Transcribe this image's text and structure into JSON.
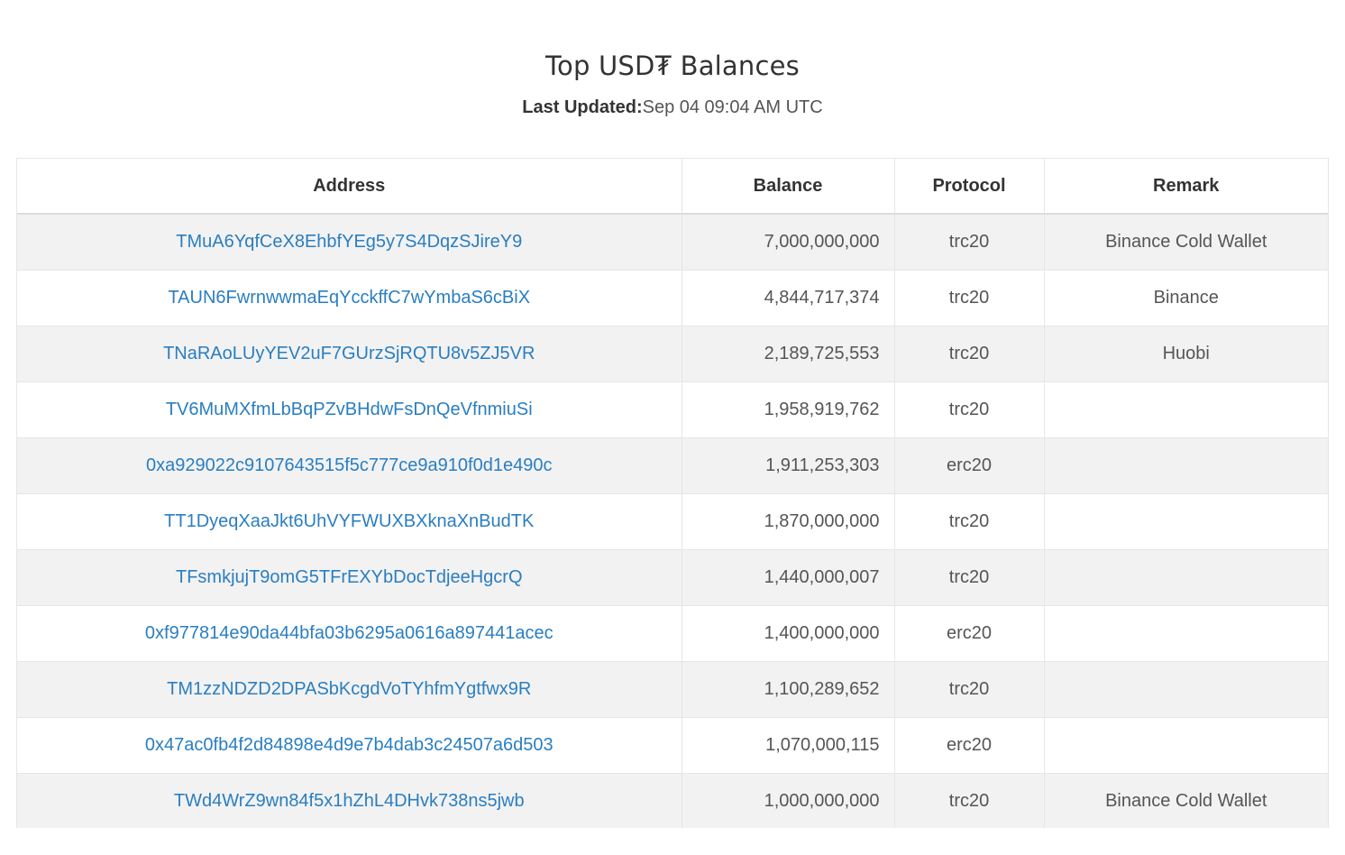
{
  "header": {
    "title": "Top USD₮ Balances",
    "updated_label": "Last Updated:",
    "updated_value": "Sep 04 09:04 AM UTC"
  },
  "table": {
    "columns": [
      "Address",
      "Balance",
      "Protocol",
      "Remark"
    ],
    "rows": [
      {
        "address": "TMuA6YqfCeX8EhbfYEg5y7S4DqzSJireY9",
        "balance": "7,000,000,000",
        "protocol": "trc20",
        "remark": "Binance Cold Wallet"
      },
      {
        "address": "TAUN6FwrnwwmaEqYcckffC7wYmbaS6cBiX",
        "balance": "4,844,717,374",
        "protocol": "trc20",
        "remark": "Binance"
      },
      {
        "address": "TNaRAoLUyYEV2uF7GUrzSjRQTU8v5ZJ5VR",
        "balance": "2,189,725,553",
        "protocol": "trc20",
        "remark": "Huobi"
      },
      {
        "address": "TV6MuMXfmLbBqPZvBHdwFsDnQeVfnmiuSi",
        "balance": "1,958,919,762",
        "protocol": "trc20",
        "remark": ""
      },
      {
        "address": "0xa929022c9107643515f5c777ce9a910f0d1e490c",
        "balance": "1,911,253,303",
        "protocol": "erc20",
        "remark": ""
      },
      {
        "address": "TT1DyeqXaaJkt6UhVYFWUXBXknaXnBudTK",
        "balance": "1,870,000,000",
        "protocol": "trc20",
        "remark": ""
      },
      {
        "address": "TFsmkjujT9omG5TFrEXYbDocTdjeeHgcrQ",
        "balance": "1,440,000,007",
        "protocol": "trc20",
        "remark": ""
      },
      {
        "address": "0xf977814e90da44bfa03b6295a0616a897441acec",
        "balance": "1,400,000,000",
        "protocol": "erc20",
        "remark": ""
      },
      {
        "address": "TM1zzNDZD2DPASbKcgdVoTYhfmYgtfwx9R",
        "balance": "1,100,289,652",
        "protocol": "trc20",
        "remark": ""
      },
      {
        "address": "0x47ac0fb4f2d84898e4d9e7b4dab3c24507a6d503",
        "balance": "1,070,000,115",
        "protocol": "erc20",
        "remark": ""
      },
      {
        "address": "TWd4WrZ9wn84f5x1hZhL4DHvk738ns5jwb",
        "balance": "1,000,000,000",
        "protocol": "trc20",
        "remark": "Binance Cold Wallet"
      }
    ]
  },
  "colors": {
    "link": "#2a7ec1",
    "stripe": "#f2f2f2"
  }
}
